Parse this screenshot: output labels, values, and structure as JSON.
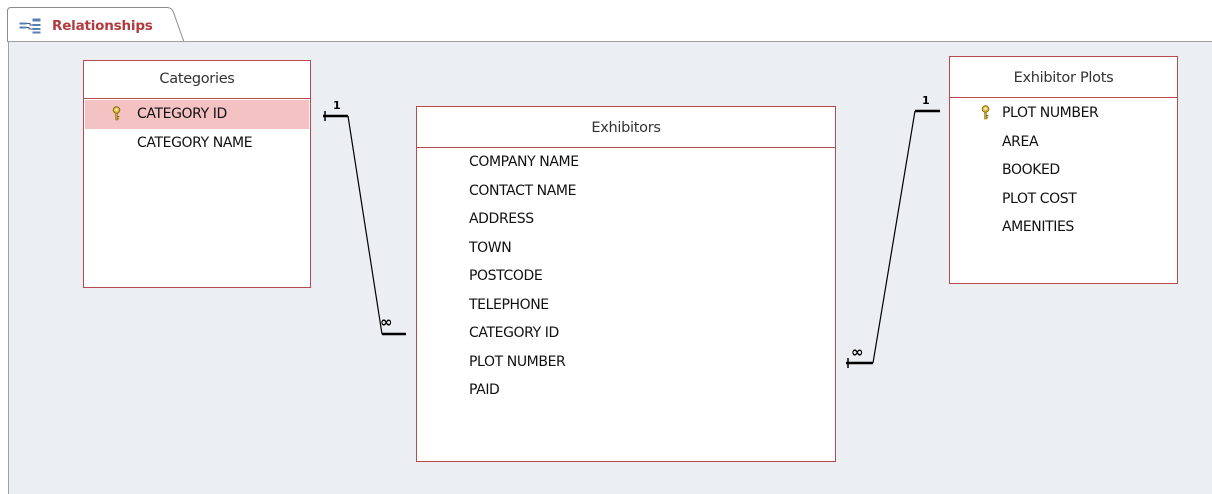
{
  "tab": {
    "label": "Relationships",
    "icon": "relationships-icon"
  },
  "tables": {
    "categories": {
      "title": "Categories",
      "fields": [
        {
          "name": "CATEGORY ID",
          "primary_key": true,
          "selected": true
        },
        {
          "name": "CATEGORY NAME",
          "primary_key": false,
          "selected": false
        }
      ]
    },
    "exhibitors": {
      "title": "Exhibitors",
      "fields": [
        {
          "name": "COMPANY NAME"
        },
        {
          "name": "CONTACT NAME"
        },
        {
          "name": "ADDRESS"
        },
        {
          "name": "TOWN"
        },
        {
          "name": "POSTCODE"
        },
        {
          "name": "TELEPHONE"
        },
        {
          "name": "CATEGORY ID"
        },
        {
          "name": "PLOT NUMBER"
        },
        {
          "name": "PAID"
        }
      ]
    },
    "exhibitor_plots": {
      "title": "Exhibitor Plots",
      "fields": [
        {
          "name": "PLOT NUMBER",
          "primary_key": true
        },
        {
          "name": "AREA",
          "primary_key": false
        },
        {
          "name": "BOOKED",
          "primary_key": false
        },
        {
          "name": "PLOT COST",
          "primary_key": false
        },
        {
          "name": "AMENITIES",
          "primary_key": false
        }
      ]
    }
  },
  "relationships": [
    {
      "from": "Categories.CATEGORY ID",
      "to": "Exhibitors.CATEGORY ID",
      "one_label": "1",
      "many_label": "∞"
    },
    {
      "from": "Exhibitor Plots.PLOT NUMBER",
      "to": "Exhibitors.PLOT NUMBER",
      "one_label": "1",
      "many_label": "∞"
    }
  ],
  "colors": {
    "accent": "#b33a3e",
    "border": "#b84a4e",
    "selection": "#f5c2c4",
    "canvas": "#ebeef2",
    "key": "#c9a227"
  }
}
